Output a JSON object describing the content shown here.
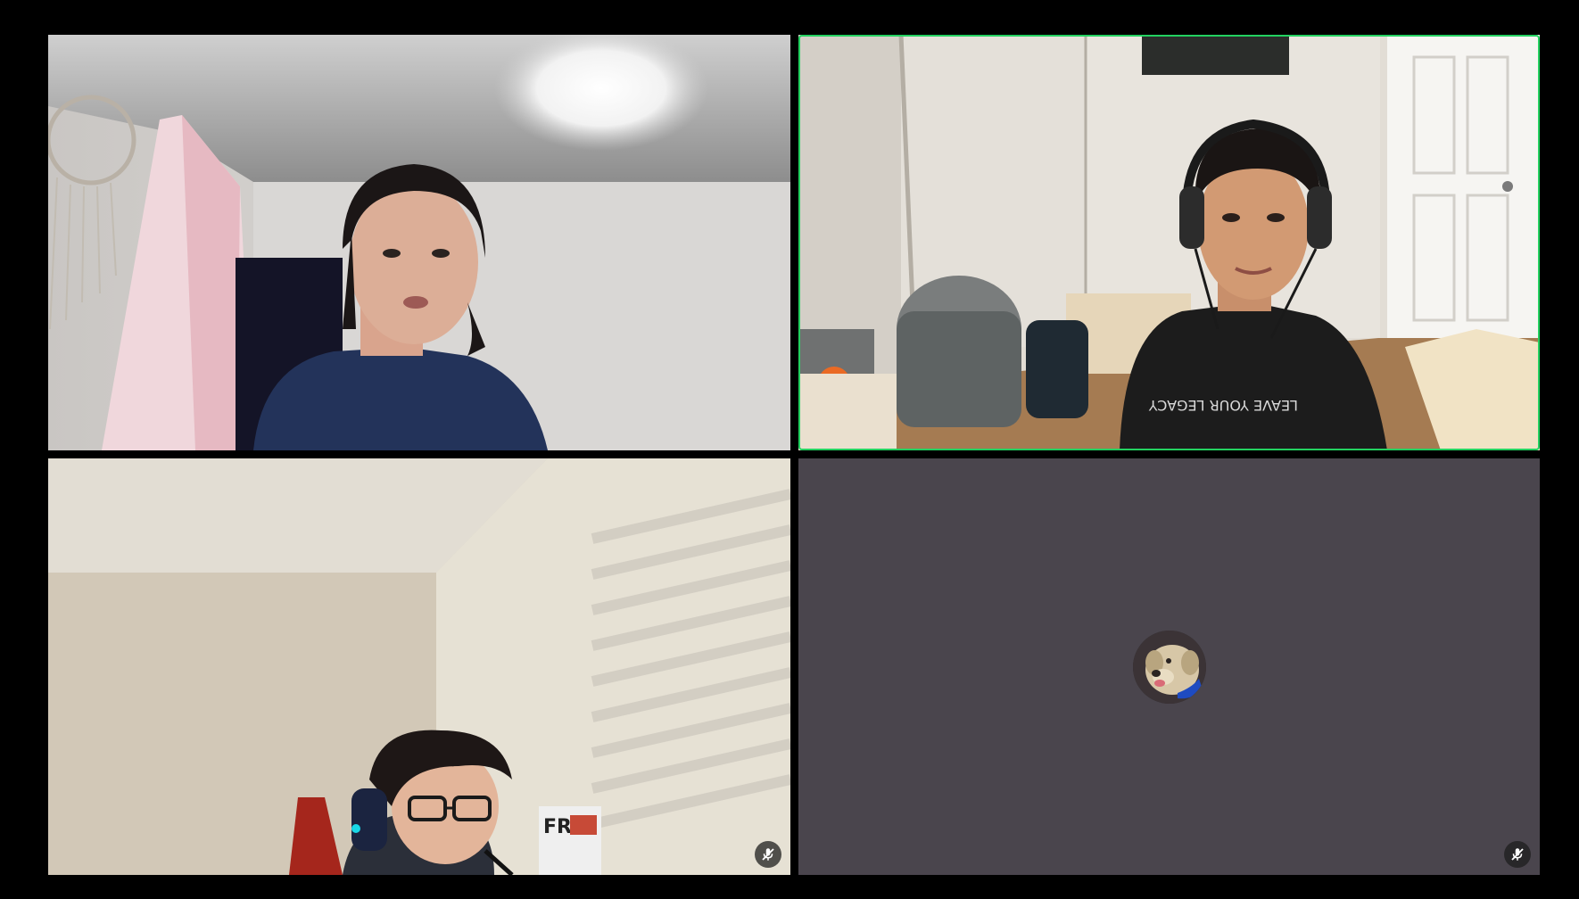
{
  "window": {
    "background": "#000000"
  },
  "participants": [
    {
      "tile": "video-feed",
      "description_icon": "video-feed",
      "muted": false,
      "active_speaker": false
    },
    {
      "tile": "video-feed",
      "description_icon": "video-feed",
      "muted": false,
      "active_speaker": true
    },
    {
      "tile": "video-feed",
      "description_icon": "video-feed",
      "muted": true,
      "active_speaker": false
    },
    {
      "tile": "avatar",
      "description_icon": "dog-avatar",
      "muted": true,
      "active_speaker": false
    }
  ],
  "colors": {
    "active_speaker_border": "#23d160",
    "avatar_tile_bg": "#4a454d",
    "mute_icon": "#ffffff"
  },
  "icons": {
    "muted": "mic-muted-icon"
  }
}
